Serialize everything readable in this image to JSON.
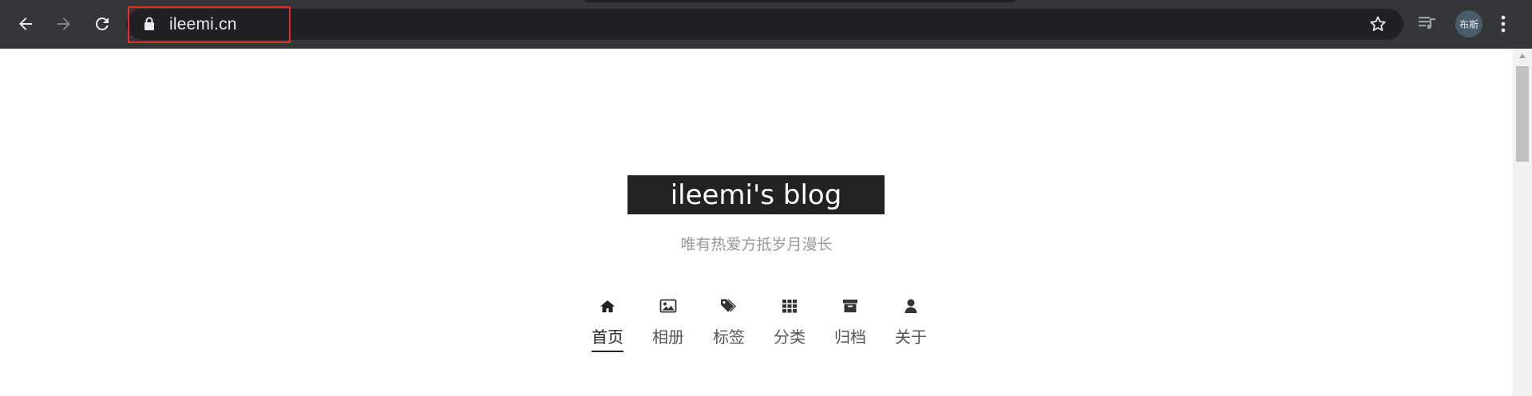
{
  "browser": {
    "url": "ileemi.cn",
    "profile_initials": "布斯",
    "icons": {
      "back": "back-arrow-icon",
      "forward": "forward-arrow-icon",
      "reload": "reload-icon",
      "lock": "lock-icon",
      "bookmark": "star-icon",
      "media": "media-playlist-icon",
      "menu": "kebab-menu-icon"
    },
    "highlight_color": "#e0302b"
  },
  "site": {
    "title": "ileemi's blog",
    "subtitle": "唯有热爱方抵岁月漫长",
    "title_bg": "#222222"
  },
  "menu": {
    "items": [
      {
        "label": "首页",
        "icon": "home-icon",
        "active": true
      },
      {
        "label": "相册",
        "icon": "image-icon",
        "active": false
      },
      {
        "label": "标签",
        "icon": "tags-icon",
        "active": false
      },
      {
        "label": "分类",
        "icon": "grid-icon",
        "active": false
      },
      {
        "label": "归档",
        "icon": "archive-icon",
        "active": false
      },
      {
        "label": "关于",
        "icon": "user-icon",
        "active": false
      }
    ]
  }
}
